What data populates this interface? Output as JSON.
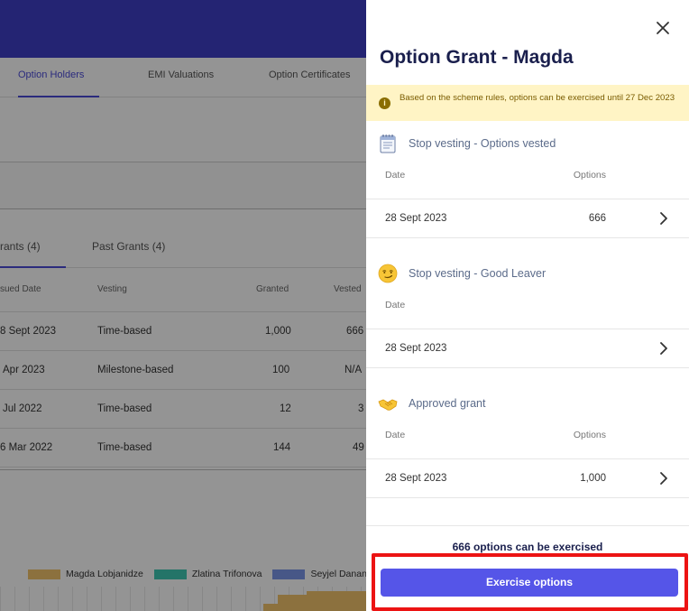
{
  "background": {
    "tabs": [
      {
        "label": "Option Holders",
        "active": true
      },
      {
        "label": "EMI Valuations",
        "active": false
      },
      {
        "label": "Option Certificates",
        "active": false
      }
    ],
    "subtabs": [
      {
        "label": "rants (4)",
        "active": true
      },
      {
        "label": "Past Grants (4)",
        "active": false
      }
    ],
    "table": {
      "headers": [
        "sued Date",
        "Vesting",
        "Granted",
        "Vested"
      ],
      "rows": [
        {
          "date": "8 Sept 2023",
          "vesting": "Time-based",
          "granted": "1,000",
          "vested": "666"
        },
        {
          "date": "Apr 2023",
          "vesting": "Milestone-based",
          "granted": "100",
          "vested": "N/A"
        },
        {
          "date": "Jul 2022",
          "vesting": "Time-based",
          "granted": "12",
          "vested": "3"
        },
        {
          "date": "6 Mar 2022",
          "vesting": "Time-based",
          "granted": "144",
          "vested": "49"
        }
      ]
    },
    "legend": [
      {
        "label": "Magda Lobjanidze",
        "color": "#f2c36b"
      },
      {
        "label": "Zlatina Trifonova",
        "color": "#3fc8b4"
      },
      {
        "label": "Seyjel Danan",
        "color": "#7b97e8"
      }
    ]
  },
  "drawer": {
    "title": "Option Grant - Magda",
    "notice": "Based on the scheme rules, options can be exercised until 27 Dec 2023",
    "sections": [
      {
        "title": "Stop vesting - Options vested",
        "date_label": "Date",
        "options_label": "Options",
        "date": "28 Sept 2023",
        "options": "666"
      },
      {
        "title": "Stop vesting - Good Leaver",
        "date_label": "Date",
        "options_label": "",
        "date": "28 Sept 2023",
        "options": ""
      },
      {
        "title": "Approved grant",
        "date_label": "Date",
        "options_label": "Options",
        "date": "28 Sept 2023",
        "options": "1,000"
      }
    ],
    "exercise_note": "666 options can be exercised",
    "exercise_button": "Exercise options"
  },
  "colors": {
    "header": "#3f3fc7",
    "accent": "#5555e8",
    "notice_bg": "#fff4c5",
    "highlight": "#ec1313"
  }
}
